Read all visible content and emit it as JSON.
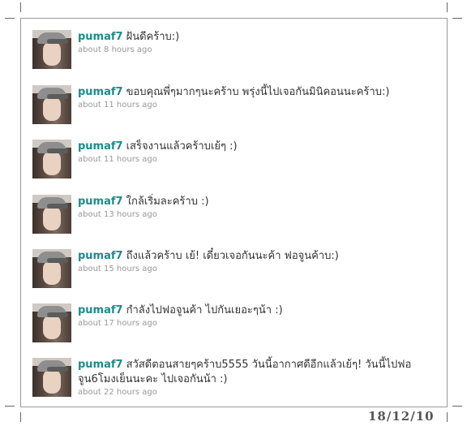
{
  "tweets": [
    {
      "user": "pumaf7",
      "text": "ฝันดีคร้าบ:)",
      "time": "about 8 hours ago"
    },
    {
      "user": "pumaf7",
      "text": "ขอบคุณพี่ๆมากๆนะคร้าบ พรุ่งนี้ไปเจอกันมินิคอนนะคร้าบ:)",
      "time": "about 11 hours ago"
    },
    {
      "user": "pumaf7",
      "text": "เสร็จงานแล้วคร้าบเย้ๆ :)",
      "time": "about 11 hours ago"
    },
    {
      "user": "pumaf7",
      "text": "ใกล้เริ่มละคร้าบ :)",
      "time": "about 13 hours ago"
    },
    {
      "user": "pumaf7",
      "text": "ถึงแล้วคร้าบ เย้! เดี๋ยวเจอกันนะค้า ฟอจูนค้าบ:)",
      "time": "about 15 hours ago"
    },
    {
      "user": "pumaf7",
      "text": "กำลังไปฟอจูนค้า ไปกันเยอะๆน้า :)",
      "time": "about 17 hours ago"
    },
    {
      "user": "pumaf7",
      "text": "สวัสดีตอนสายๆคร้าบ5555 วันนี้อากาศดีอีกแล้วเย้ๆ! วันนี้ไปฟอจูน6โมงเย็นนะคะ ไปเจอกันน้า :)",
      "time": "about 22 hours ago"
    }
  ],
  "stamp": "18/12/10"
}
